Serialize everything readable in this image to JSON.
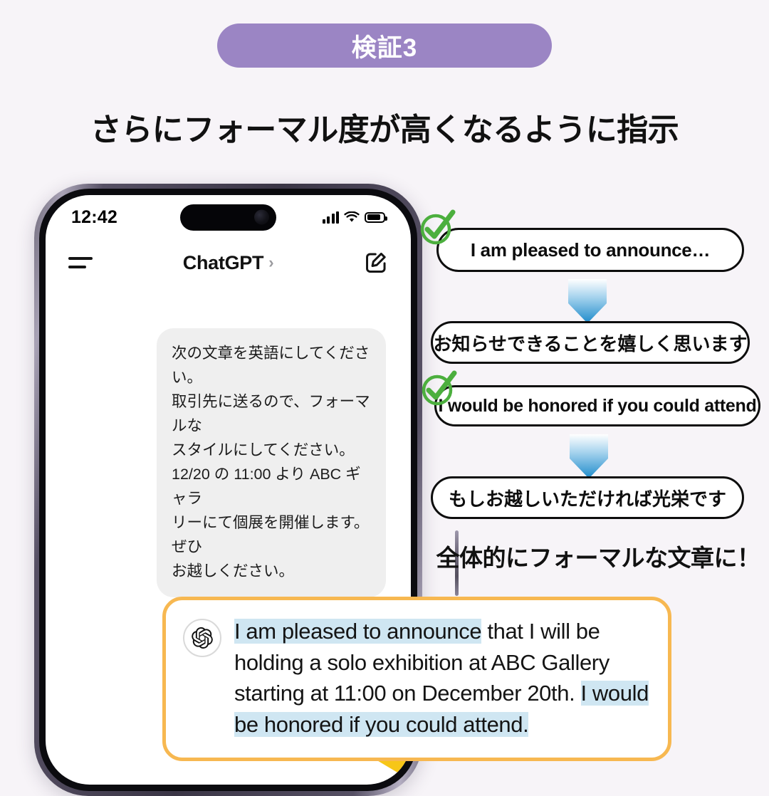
{
  "background_color": "#F7F4F8",
  "header": {
    "badge_label": "検証3",
    "badge_color": "#9B85C4",
    "headline": "さらにフォーマル度が高くなるように指示"
  },
  "phone": {
    "status_bar": {
      "time": "12:42",
      "signal_icon": "cellular-signal-icon",
      "wifi_icon": "wifi-icon",
      "battery_icon": "battery-icon"
    },
    "nav_bar": {
      "menu_icon": "hamburger-menu-icon",
      "title": "ChatGPT",
      "chevron": "›",
      "compose_icon": "compose-icon"
    },
    "user_message": "次の文章を英語にしてください。\n取引先に送るので、フォーマルな\nスタイルにしてください。\n12/20 の 11:00 より ABC ギャラ\nリーにて個展を開催します。ぜひ\nお越しください。",
    "arrow_icon": "curved-down-arrow-icon",
    "arrow_color": "#F7C617"
  },
  "response_card": {
    "avatar_icon": "openai-logo-icon",
    "border_color": "#F7B851",
    "highlight_color": "#CFE6F2",
    "segments": [
      {
        "text": "I am pleased to announce",
        "highlighted": true
      },
      {
        "text": " that I will be holding a solo exhibition at ABC Gallery starting at 11:00 on December 20th. ",
        "highlighted": false
      },
      {
        "text": "I would be honored if you could attend.",
        "highlighted": true
      }
    ]
  },
  "annotations": {
    "check_icon": "green-check-icon",
    "check_color": "#4CAF3E",
    "down_arrow_icon": "blue-gradient-down-arrow-icon",
    "arrow_color_top": "#FFFFFF",
    "arrow_color_bottom": "#1E8BCB",
    "pairs": [
      {
        "english": "I am pleased to announce…",
        "japanese": "お知らせできることを嬉しく思います"
      },
      {
        "english": "I would be honored if you could attend",
        "japanese": "もしお越しいただければ光栄です"
      }
    ],
    "caption": "全体的にフォーマルな文章に！"
  }
}
